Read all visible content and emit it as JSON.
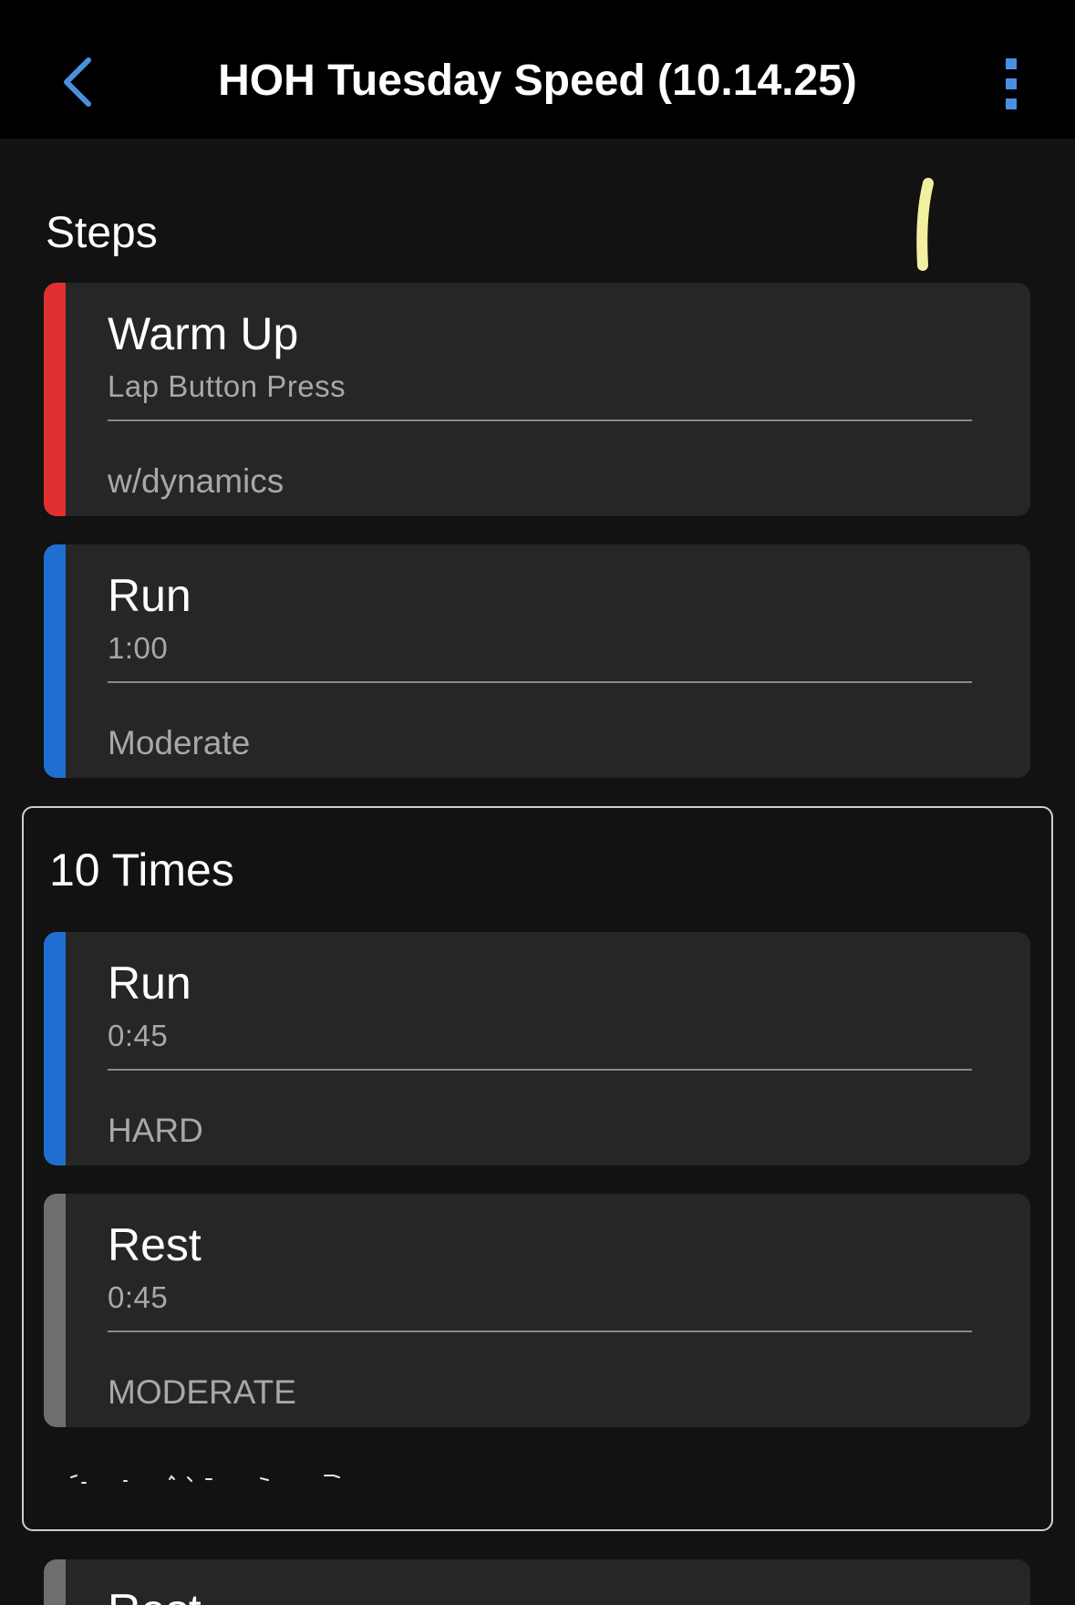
{
  "header": {
    "title": "HOH Tuesday Speed (10.14.25)",
    "accent_color": "#4a90e2",
    "back_icon": "chevron-left-icon",
    "menu_icon": "more-vertical-icon"
  },
  "section": {
    "heading": "Steps"
  },
  "steps": [
    {
      "name": "Warm Up",
      "duration": "Lap Button Press",
      "note": "w/dynamics",
      "color": "#e03030"
    },
    {
      "name": "Run",
      "duration": "1:00",
      "note": "Moderate",
      "color": "#1f6fd1"
    }
  ],
  "repeat": {
    "title": "10 Times",
    "steps": [
      {
        "name": "Run",
        "duration": "0:45",
        "note": "HARD",
        "color": "#1f6fd1"
      },
      {
        "name": "Rest",
        "duration": "0:45",
        "note": "MODERATE",
        "color": "#6e6e6e"
      }
    ]
  },
  "next_step": {
    "name": "Rest",
    "color": "#6e6e6e"
  }
}
